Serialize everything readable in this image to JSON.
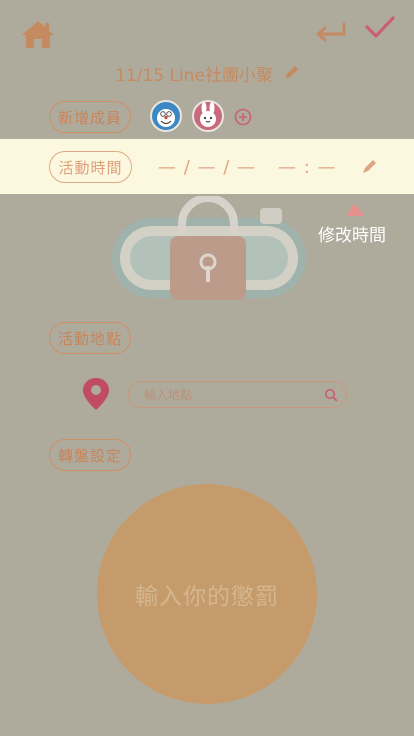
{
  "header": {
    "title": "11/15 Line社團小聚"
  },
  "members": {
    "add_label": "新增成員",
    "avatars": [
      "doraemon-avatar",
      "cony-avatar"
    ]
  },
  "time": {
    "label": "活動時間",
    "date_placeholder": "— / — / —",
    "time_placeholder": "— : —",
    "hint": "修改時間"
  },
  "location": {
    "label": "活動地點",
    "search_placeholder": "輸入地點"
  },
  "wheel": {
    "label": "轉盤設定",
    "placeholder": "輸入你的懲罰"
  },
  "colors": {
    "background": "#aeab9d",
    "accent": "#c9845a",
    "highlight": "#fbf8df",
    "wheel": "#c59b6c",
    "pin": "#c04b63"
  }
}
